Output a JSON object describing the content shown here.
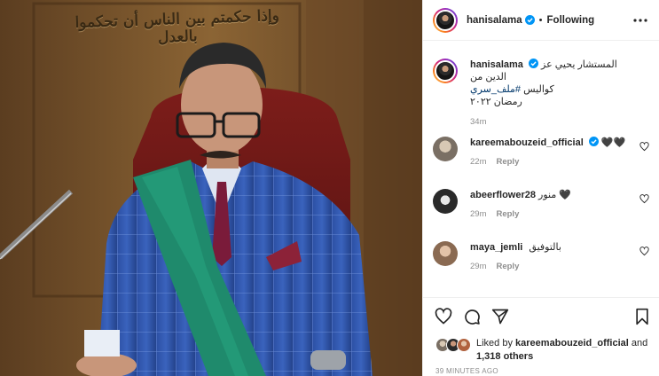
{
  "post": {
    "author": "hanisalama",
    "following_label": "Following",
    "separator": "•",
    "wall_inscription": "وإذا حكمتم بين الناس أن تحكموا بالعدل"
  },
  "caption": {
    "username": "hanisalama",
    "line1": "المستشار يحيي عز الدين من",
    "line2_prefix": "كواليس ",
    "hashtag": "#ملف_سري",
    "line3": "رمضان ٢٠٢٢",
    "time": "34m"
  },
  "comments": [
    {
      "username": "kareemabouzeid_official",
      "text": "🖤🖤",
      "time": "22m",
      "reply_label": "Reply",
      "verified": true
    },
    {
      "username": "abeerflower28",
      "text": "منور 🖤",
      "time": "29m",
      "reply_label": "Reply",
      "verified": false
    },
    {
      "username": "maya_jemli",
      "text": "بالتوفيق",
      "time": "29m",
      "reply_label": "Reply",
      "verified": false
    }
  ],
  "likes": {
    "prefix": "Liked by ",
    "first_user": "kareemabouzeid_official",
    "middle": " and",
    "others": "1,318 others"
  },
  "posted_ago": "39 MINUTES AGO",
  "icons": [
    "heart-icon",
    "comment-icon",
    "share-icon",
    "save-icon",
    "more-icon",
    "verified-icon"
  ],
  "colors": {
    "verified_blue": "#0095f6",
    "link": "#00376b",
    "muted": "#8e8e8e"
  }
}
